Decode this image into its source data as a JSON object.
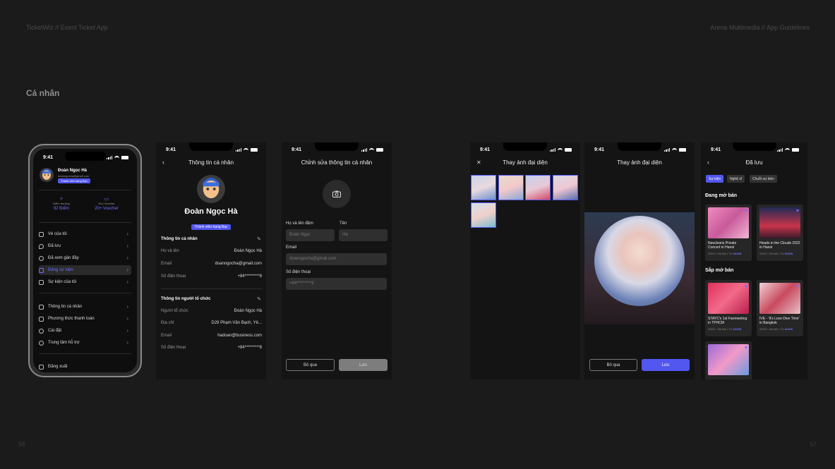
{
  "header": {
    "left": "TicketWiz // Event Ticket App",
    "right": "Arena Multimedia // App Guidelines"
  },
  "section_title": "Cá nhân",
  "page_numbers": {
    "left": "56",
    "right": "57"
  },
  "status_time": "9:41",
  "profile_menu": {
    "name": "Đoàn Ngọc Hà",
    "email": "doanngocha@gmail.com",
    "badge": "Thành viên hạng Bạc",
    "points_label": "Điểm thưởng",
    "points_value": "92 Điểm",
    "voucher_label": "Kho Voucher",
    "voucher_value": "20+ Voucher",
    "items": [
      "Vé của tôi",
      "Đã lưu",
      "Đã xem gần đây",
      "Đăng sự kiện",
      "Sự kiện của tôi"
    ],
    "items2": [
      "Thông tin cá nhân",
      "Phương thức thanh toán",
      "Cài đặt",
      "Trung tâm hỗ trợ"
    ],
    "logout": "Đăng xuất"
  },
  "personal_info": {
    "title": "Thông tin cá nhân",
    "name": "Đoàn Ngọc Hà",
    "badge": "Thành viên hạng Bạc",
    "section1": "Thông tin cá nhân",
    "rows1": [
      {
        "k": "Họ và tên",
        "v": "Đoàn Ngọc Hà"
      },
      {
        "k": "Email",
        "v": "doanngocha@gmail.com"
      },
      {
        "k": "Số điện thoại",
        "v": "+84*********8"
      }
    ],
    "section2": "Thông tin người tổ chức",
    "rows2": [
      {
        "k": "Người tổ chức",
        "v": "Đoàn Ngọc Hà"
      },
      {
        "k": "Địa chỉ",
        "v": "D29 Phạm Văn Bạch, Yê..."
      },
      {
        "k": "Email",
        "v": "hadoan@business.com"
      },
      {
        "k": "Số điện thoại",
        "v": "+84*********8"
      }
    ]
  },
  "edit_info": {
    "title": "Chỉnh sửa thông tin cá nhân",
    "label_middle": "Họ và tên đệm",
    "label_first": "Tên",
    "middle_value": "Đoàn Ngọc",
    "first_value": "Hà",
    "label_email": "Email",
    "email_value": "doanngocha@gmail.com",
    "label_phone": "Số điện thoại",
    "phone_value": "+84*********8",
    "cancel": "Bỏ qua",
    "save": "Lưu"
  },
  "change_avatar": {
    "title": "Thay ảnh đại diện"
  },
  "avatar_crop": {
    "title": "Thay ảnh đại diện",
    "cancel": "Bỏ qua",
    "save": "Lưu"
  },
  "saved": {
    "title": "Đã lưu",
    "chips": [
      "Sự kiện",
      "Nghệ sĩ",
      "Chuỗi sự kiện"
    ],
    "sec_open": "Đang mở bán",
    "sec_upcoming": "Sắp mở bán",
    "cards": [
      {
        "title": "NewJeans Private Concert in Hanoi",
        "meta": "20/02 • Hà Nội • Từ ",
        "price": "đ430K"
      },
      {
        "title": "Heads in the Clouds 2022 in Hanoi",
        "meta": "20/02 • Hà Nội • Từ ",
        "price": "đ430K"
      },
      {
        "title": "STAYC's 1st Fanmeeting in TPHCM",
        "meta": "20/02 • Hà Nội • Từ ",
        "price": "đ430K"
      },
      {
        "title": "IVE - 'It's Love Dive Time' in Bangkok",
        "meta": "20/02 • Hà Nội • Từ ",
        "price": "đ430K"
      }
    ]
  },
  "colors": {
    "accent": "#5257f0",
    "bg": "#1b1b1b",
    "screen": "#141414"
  }
}
